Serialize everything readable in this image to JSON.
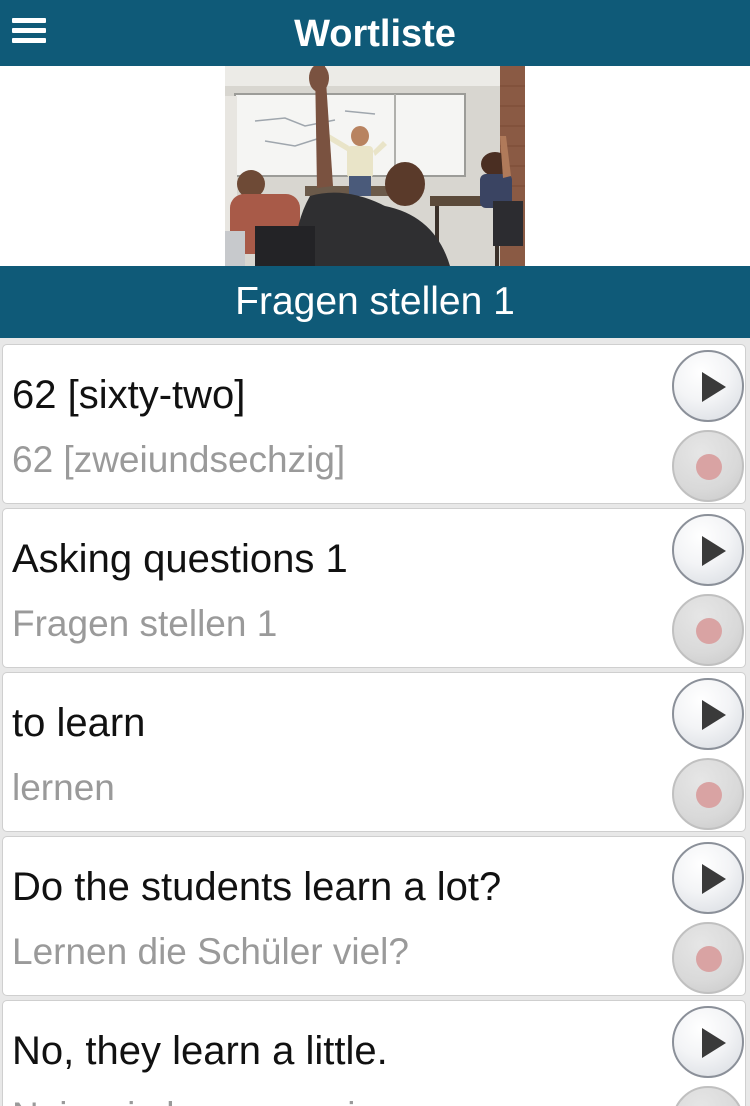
{
  "header": {
    "title": "Wortliste",
    "menu_icon": "hamburger-menu-icon"
  },
  "lesson": {
    "title": "Fragen stellen 1"
  },
  "phrases": [
    {
      "english": "62 [sixty-two]",
      "german": "62 [zweiundsechzig]"
    },
    {
      "english": "Asking questions 1",
      "german": "Fragen stellen 1"
    },
    {
      "english": "to learn",
      "german": "lernen"
    },
    {
      "english": "Do the students learn a lot?",
      "german": "Lernen die Schüler viel?"
    },
    {
      "english": "No, they learn a little.",
      "german": "Nein, sie lernen wenig."
    }
  ],
  "colors": {
    "header_bg": "#0f5a78",
    "text_primary": "#111111",
    "text_secondary": "#9a9a9a",
    "record_dot": "#d9a3a3"
  }
}
